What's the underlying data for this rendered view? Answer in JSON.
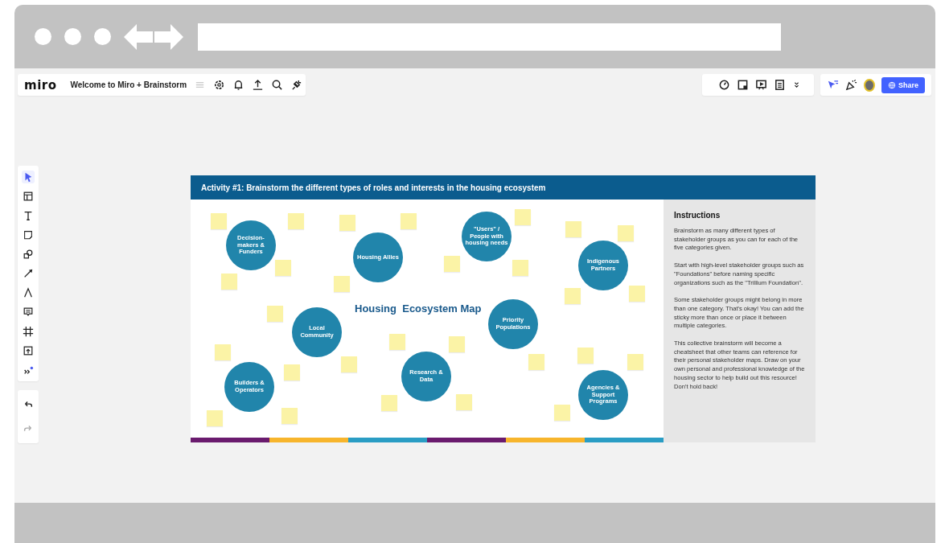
{
  "topbar": {
    "logo": "miro",
    "board_title": "Welcome to Miro + Brainstorm",
    "share_button": "Share"
  },
  "tools": [
    {
      "kind": "select",
      "selected": true
    },
    {
      "kind": "template",
      "selected": false
    },
    {
      "kind": "text",
      "selected": false
    },
    {
      "kind": "sticky",
      "selected": false
    },
    {
      "kind": "shapes",
      "selected": false
    },
    {
      "kind": "line",
      "selected": false
    },
    {
      "kind": "pen",
      "selected": false
    },
    {
      "kind": "comment",
      "selected": false
    },
    {
      "kind": "frame",
      "selected": false
    },
    {
      "kind": "upload",
      "selected": false
    },
    {
      "kind": "more",
      "selected": false
    }
  ],
  "history": [
    {
      "kind": "undo",
      "disabled": false
    },
    {
      "kind": "redo",
      "disabled": true
    }
  ],
  "frame": {
    "header": "Activity #1:  Brainstorm the different types of roles and interests in the housing ecosystem",
    "map_title": "Housing  Ecosystem Map",
    "circles": [
      {
        "label": "Decision-makers & Funders"
      },
      {
        "label": "Housing Allies"
      },
      {
        "label": "\"Users\" / People with housing needs"
      },
      {
        "label": "Indigenous Partners"
      },
      {
        "label": "Local Community"
      },
      {
        "label": "Priority Populations"
      },
      {
        "label": "Research & Data"
      },
      {
        "label": "Builders & Operators"
      },
      {
        "label": "Agencies & Support Programs"
      }
    ],
    "instructions": {
      "title": "Instructions",
      "paragraphs": [
        "Brainstorm as many different types of stakeholder groups as you can for each of the five categories given.",
        "Start with high-level stakeholder groups such as \"Foundations\" before naming specific organizations such as the \"Trillium Foundation\".",
        "Some stakeholder groups might belong in more than one category. That's okay! You can add the sticky more than once or place it between multiple categories.",
        "This collective brainstorm will become a cheatsheet that other teams can reference for their personal stakeholder maps. Draw on your own personal and professional knowledge of the housing sector to help build out this resource! Don't hold back!"
      ]
    }
  }
}
